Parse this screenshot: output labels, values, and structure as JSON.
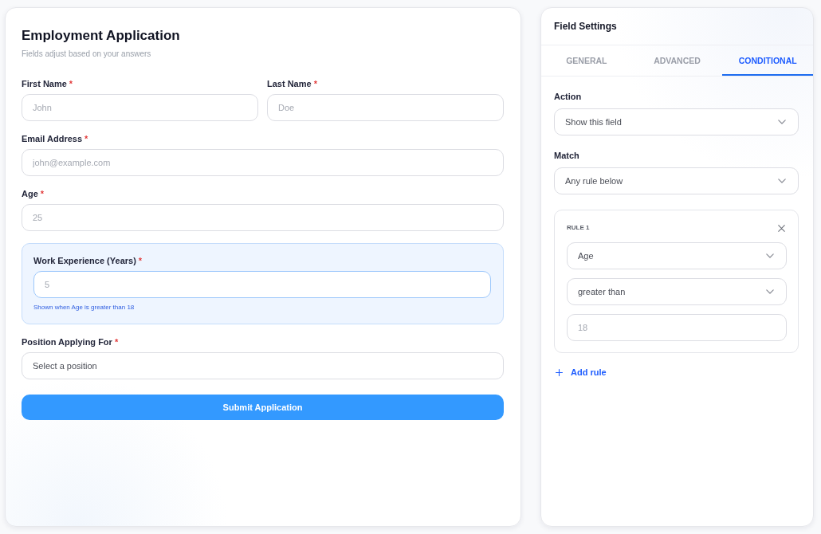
{
  "form": {
    "title": "Employment Application",
    "subtitle": "Fields adjust based on your answers",
    "rows": [
      {
        "fields": [
          {
            "kind": "input",
            "label": "First Name",
            "required_mark": "*",
            "placeholder": "John"
          },
          {
            "kind": "input",
            "label": "Last Name",
            "required_mark": "*",
            "placeholder": "Doe"
          }
        ]
      },
      {
        "fields": [
          {
            "kind": "input",
            "label": "Email Address",
            "required_mark": "*",
            "placeholder": "john@example.com"
          }
        ]
      },
      {
        "fields": [
          {
            "kind": "input",
            "label": "Age",
            "required_mark": "*",
            "placeholder": "25"
          }
        ]
      },
      {
        "fields": [
          {
            "kind": "conditional",
            "label": "Work Experience (Years)",
            "required_mark": "*",
            "placeholder": "5",
            "hint": "Shown when Age is greater than 18"
          }
        ]
      },
      {
        "fields": [
          {
            "kind": "select",
            "label": "Position Applying For",
            "required_mark": "*",
            "value": "Select a position"
          }
        ]
      }
    ],
    "submit": "Submit Application"
  },
  "settings": {
    "title": "Field Settings",
    "tabs": [
      {
        "label": "GENERAL",
        "selected": false
      },
      {
        "label": "ADVANCED",
        "selected": false
      },
      {
        "label": "CONDITIONAL",
        "selected": true
      }
    ],
    "selects": [
      {
        "label": "Action",
        "value": "Show this field"
      },
      {
        "label": "Match",
        "value": "Any rule below"
      }
    ],
    "rules": [
      {
        "title": "RULE 1",
        "conditions": [
          {
            "kind": "select",
            "value": "Age"
          },
          {
            "kind": "select",
            "value": "greater than"
          },
          {
            "kind": "input",
            "placeholder": "18"
          }
        ]
      }
    ],
    "add_rule": "Add rule"
  }
}
